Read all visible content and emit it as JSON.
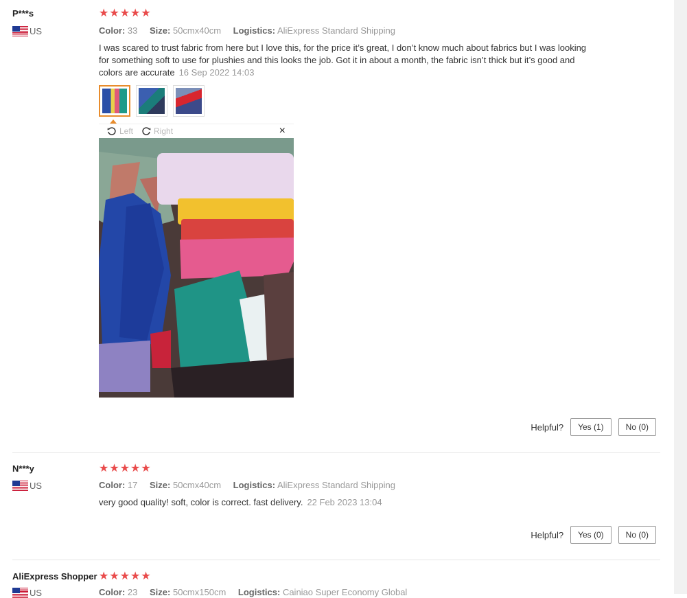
{
  "reviews": [
    {
      "user": "P***s",
      "country": "US",
      "stars": 5,
      "color_label": "Color:",
      "color": "33",
      "size_label": "Size:",
      "size": "50cmx40cm",
      "logistics_label": "Logistics:",
      "logistics": "AliExpress Standard Shipping",
      "text": "I was scared to trust fabric from here but I love this, for the price it’s great, I don’t know much about fabrics but I was looking for something soft to use for plushies and this looks the job. Got it in about a month, the fabric isn’t thick but it’s good and colors are accurate",
      "date": "16 Sep 2022 14:03",
      "helpful_label": "Helpful?",
      "yes": "Yes (1)",
      "no": "No (0)"
    },
    {
      "user": "N***y",
      "country": "US",
      "stars": 5,
      "color_label": "Color:",
      "color": "17",
      "size_label": "Size:",
      "size": "50cmx40cm",
      "logistics_label": "Logistics:",
      "logistics": "AliExpress Standard Shipping",
      "text": "very good quality! soft, color is correct. fast delivery.",
      "date": "22 Feb 2023 13:04",
      "helpful_label": "Helpful?",
      "yes": "Yes (0)",
      "no": "No (0)"
    },
    {
      "user": "AliExpress Shopper",
      "country": "US",
      "stars": 5,
      "color_label": "Color:",
      "color": "23",
      "size_label": "Size:",
      "size": "50cmx150cm",
      "logistics_label": "Logistics:",
      "logistics": "Cainiao Super Economy Global"
    }
  ],
  "viewer": {
    "rotate_left": "Left",
    "rotate_right": "Right",
    "close": "×"
  },
  "icons": {
    "star": "★",
    "rotate_left": "rotate-left-icon",
    "rotate_right": "rotate-right-icon",
    "close": "close-icon",
    "flag": "us-flag-icon"
  },
  "colors": {
    "star": "#e94b4b",
    "thumb_active": "#e88c2c"
  }
}
